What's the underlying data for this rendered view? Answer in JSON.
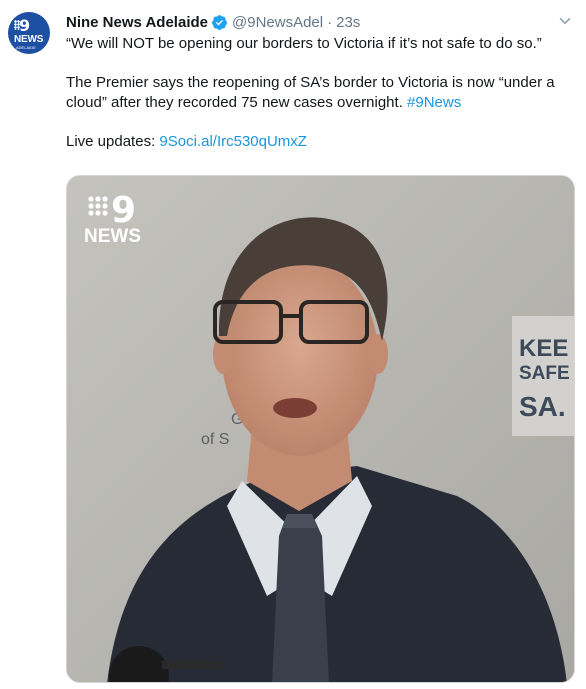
{
  "author": {
    "name": "Nine News Adelaide",
    "handle": "@9NewsAdel",
    "separator": "·",
    "time": "23s",
    "avatar_text": "NEWS",
    "avatar_sub": "ADELAIDE"
  },
  "tweet": {
    "line1": "“We will NOT be opening our borders to Victoria if it’s not safe to do so.”",
    "line2_text": "The Premier says the reopening of SA’s border to Victoria is now “under a cloud” after they recorded 75 new cases overnight. ",
    "hashtag": "#9News",
    "live_label": "Live updates: ",
    "live_link": "9Soci.al/Irc530qUmxZ"
  },
  "media": {
    "watermark": "NEWS",
    "backdrop_text_1": "KEE",
    "backdrop_text_2": "SAFE",
    "backdrop_text_3": "SA.",
    "backdrop_left_1": "G",
    "backdrop_left_2": "of S"
  },
  "colors": {
    "link": "#1b95e0",
    "verified": "#1da1f2",
    "brand": "#1d4fa3"
  },
  "icons": [
    "verified-badge-icon",
    "chevron-down-icon"
  ]
}
